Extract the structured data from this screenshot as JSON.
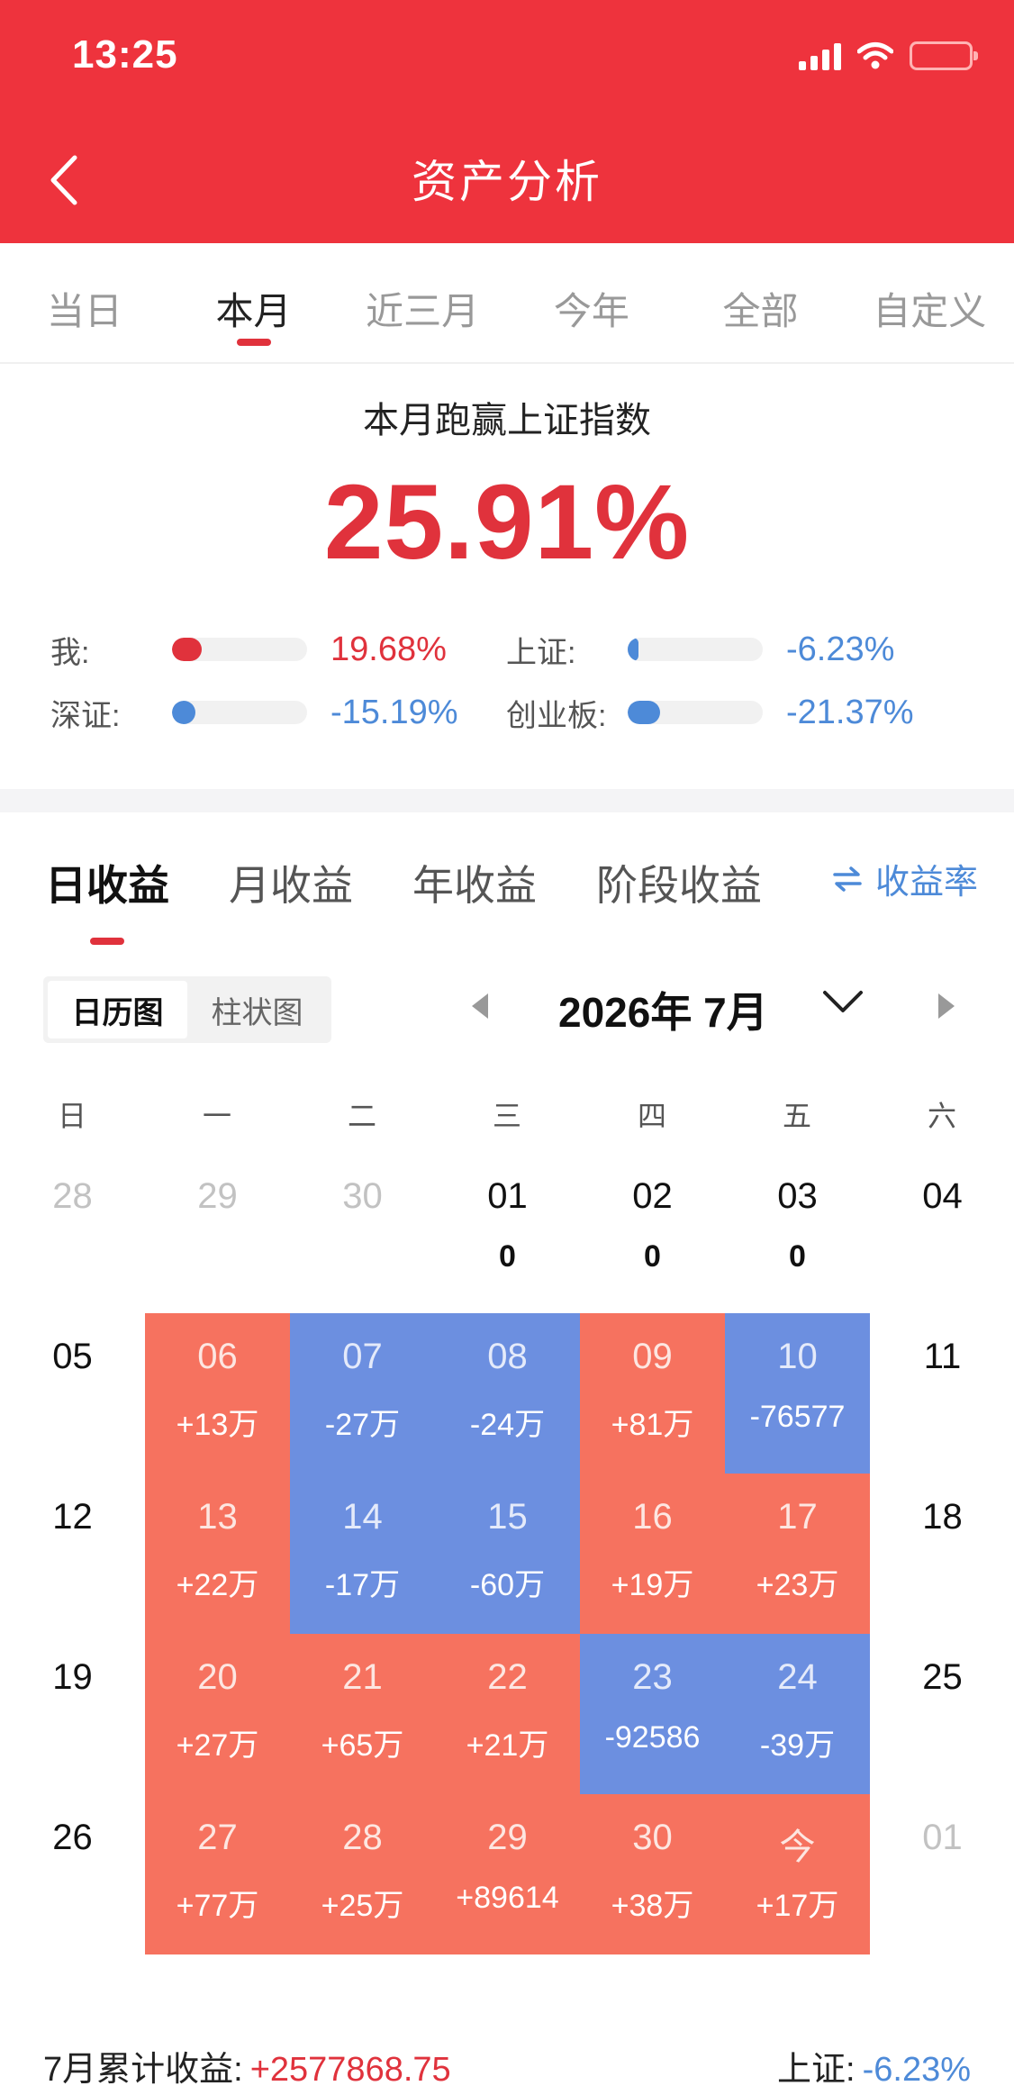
{
  "status_bar": {
    "time": "13:25"
  },
  "header": {
    "title": "资产分析"
  },
  "period_tabs": [
    {
      "label": "当日",
      "active": false
    },
    {
      "label": "本月",
      "active": true
    },
    {
      "label": "近三月",
      "active": false
    },
    {
      "label": "今年",
      "active": false
    },
    {
      "label": "全部",
      "active": false
    },
    {
      "label": "自定义",
      "active": false
    }
  ],
  "summary": {
    "title": "本月跑赢上证指数",
    "value": "25.91%",
    "compare": [
      {
        "label": "我:",
        "value": "19.68%",
        "bar_fraction": 0.22,
        "color": "#e0323c",
        "tone": "red"
      },
      {
        "label": "上证:",
        "value": "-6.23%",
        "bar_fraction": 0.08,
        "color": "#4d8ad8",
        "tone": "blue"
      },
      {
        "label": "深证:",
        "value": "-15.19%",
        "bar_fraction": 0.17,
        "color": "#4d8ad8",
        "tone": "blue"
      },
      {
        "label": "创业板:",
        "value": "-21.37%",
        "bar_fraction": 0.24,
        "color": "#4d8ad8",
        "tone": "blue"
      }
    ]
  },
  "income_tabs": [
    {
      "label": "日收益",
      "active": true
    },
    {
      "label": "月收益",
      "active": false
    },
    {
      "label": "年收益",
      "active": false
    },
    {
      "label": "阶段收益",
      "active": false
    }
  ],
  "rate_toggle": {
    "label": "收益率",
    "icon": "swap-arrows-icon"
  },
  "view_toggle": [
    {
      "label": "日历图",
      "active": true
    },
    {
      "label": "柱状图",
      "active": false
    }
  ],
  "month_selector": {
    "label": "2026年 7月"
  },
  "calendar": {
    "weekdays": [
      "日",
      "一",
      "二",
      "三",
      "四",
      "五",
      "六"
    ],
    "weeks": [
      [
        {
          "day": "28",
          "value": "",
          "kind": "other"
        },
        {
          "day": "29",
          "value": "",
          "kind": "other"
        },
        {
          "day": "30",
          "value": "",
          "kind": "other"
        },
        {
          "day": "01",
          "value": "0",
          "kind": "plain"
        },
        {
          "day": "02",
          "value": "0",
          "kind": "plain"
        },
        {
          "day": "03",
          "value": "0",
          "kind": "plain"
        },
        {
          "day": "04",
          "value": "",
          "kind": "plain"
        }
      ],
      [
        {
          "day": "05",
          "value": "",
          "kind": "plain"
        },
        {
          "day": "06",
          "value": "+13万",
          "kind": "up"
        },
        {
          "day": "07",
          "value": "-27万",
          "kind": "down"
        },
        {
          "day": "08",
          "value": "-24万",
          "kind": "down"
        },
        {
          "day": "09",
          "value": "+81万",
          "kind": "up"
        },
        {
          "day": "10",
          "value": "-76577",
          "kind": "down"
        },
        {
          "day": "11",
          "value": "",
          "kind": "plain"
        }
      ],
      [
        {
          "day": "12",
          "value": "",
          "kind": "plain"
        },
        {
          "day": "13",
          "value": "+22万",
          "kind": "up"
        },
        {
          "day": "14",
          "value": "-17万",
          "kind": "down"
        },
        {
          "day": "15",
          "value": "-60万",
          "kind": "down"
        },
        {
          "day": "16",
          "value": "+19万",
          "kind": "up"
        },
        {
          "day": "17",
          "value": "+23万",
          "kind": "up"
        },
        {
          "day": "18",
          "value": "",
          "kind": "plain"
        }
      ],
      [
        {
          "day": "19",
          "value": "",
          "kind": "plain"
        },
        {
          "day": "20",
          "value": "+27万",
          "kind": "up"
        },
        {
          "day": "21",
          "value": "+65万",
          "kind": "up"
        },
        {
          "day": "22",
          "value": "+21万",
          "kind": "up"
        },
        {
          "day": "23",
          "value": "-92586",
          "kind": "down"
        },
        {
          "day": "24",
          "value": "-39万",
          "kind": "down"
        },
        {
          "day": "25",
          "value": "",
          "kind": "plain"
        }
      ],
      [
        {
          "day": "26",
          "value": "",
          "kind": "plain"
        },
        {
          "day": "27",
          "value": "+77万",
          "kind": "up"
        },
        {
          "day": "28",
          "value": "+25万",
          "kind": "up"
        },
        {
          "day": "29",
          "value": "+89614",
          "kind": "up"
        },
        {
          "day": "30",
          "value": "+38万",
          "kind": "up"
        },
        {
          "day": "今",
          "value": "+17万",
          "kind": "up"
        },
        {
          "day": "01",
          "value": "",
          "kind": "other"
        }
      ]
    ]
  },
  "footer": {
    "cumulative_label": "7月累计收益:",
    "cumulative_value": "+2577868.75",
    "index_label": "上证:",
    "index_value": "-6.23%"
  },
  "colors": {
    "brand_red": "#ee333d",
    "gain": "#f6725f",
    "loss": "#6c8fe0",
    "accent_blue": "#4d8ad8"
  }
}
